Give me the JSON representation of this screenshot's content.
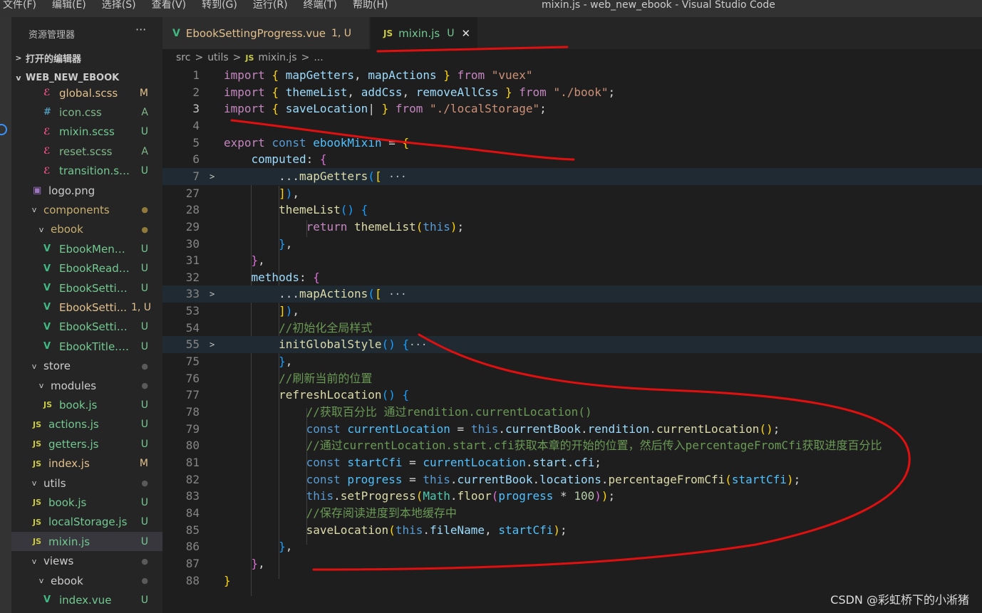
{
  "menu": [
    "文件(F)",
    "编辑(E)",
    "选择(S)",
    "查看(V)",
    "转到(G)",
    "运行(R)",
    "终端(T)",
    "帮助(H)"
  ],
  "window_title": "mixin.js - web_new_ebook - Visual Studio Code",
  "sidebar": {
    "header": "资源管理器",
    "more": "···",
    "open_editors": "打开的编辑器",
    "project": "WEB_NEW_EBOOK",
    "tree": [
      {
        "name": "global.scss",
        "icon": "scss-icon",
        "badge": "M",
        "status": "modified"
      },
      {
        "name": "icon.css",
        "icon": "css-icon",
        "badge": "A",
        "status": "added"
      },
      {
        "name": "mixin.scss",
        "icon": "scss-icon",
        "badge": "U",
        "status": "untracked"
      },
      {
        "name": "reset.scss",
        "icon": "scss-icon",
        "badge": "A",
        "status": "added"
      },
      {
        "name": "transition.scss",
        "icon": "scss-icon",
        "badge": "U",
        "status": "untracked"
      },
      {
        "name": "logo.png",
        "icon": "image-icon",
        "badge": "",
        "status": "plain"
      },
      {
        "name": "components",
        "icon": "folder",
        "badge": "●",
        "status": "folder-mod"
      },
      {
        "name": "ebook",
        "icon": "folder",
        "badge": "●",
        "status": "folder-mod"
      },
      {
        "name": "EbookMenu....",
        "icon": "vue-icon",
        "badge": "U",
        "status": "untracked"
      },
      {
        "name": "EbookReade...",
        "icon": "vue-icon",
        "badge": "U",
        "status": "untracked"
      },
      {
        "name": "EbookSettin...",
        "icon": "vue-icon",
        "badge": "U",
        "status": "untracked"
      },
      {
        "name": "EbookSetti...",
        "icon": "vue-icon",
        "badge": "1, U",
        "status": "conflict"
      },
      {
        "name": "EbookSettin...",
        "icon": "vue-icon",
        "badge": "U",
        "status": "untracked"
      },
      {
        "name": "EbookTitle.v...",
        "icon": "vue-icon",
        "badge": "U",
        "status": "untracked"
      },
      {
        "name": "store",
        "icon": "folder",
        "badge": "●",
        "status": "folder"
      },
      {
        "name": "modules",
        "icon": "folder",
        "badge": "●",
        "status": "folder"
      },
      {
        "name": "book.js",
        "icon": "js-icon",
        "badge": "U",
        "status": "untracked"
      },
      {
        "name": "actions.js",
        "icon": "js-icon",
        "badge": "U",
        "status": "untracked"
      },
      {
        "name": "getters.js",
        "icon": "js-icon",
        "badge": "U",
        "status": "untracked"
      },
      {
        "name": "index.js",
        "icon": "js-icon",
        "badge": "M",
        "status": "modified"
      },
      {
        "name": "utils",
        "icon": "folder",
        "badge": "●",
        "status": "folder"
      },
      {
        "name": "book.js",
        "icon": "js-icon",
        "badge": "U",
        "status": "untracked"
      },
      {
        "name": "localStorage.js",
        "icon": "js-icon",
        "badge": "U",
        "status": "untracked"
      },
      {
        "name": "mixin.js",
        "icon": "js-icon",
        "badge": "U",
        "status": "untracked",
        "selected": true
      },
      {
        "name": "views",
        "icon": "folder",
        "badge": "●",
        "status": "folder"
      },
      {
        "name": "ebook",
        "icon": "folder",
        "badge": "●",
        "status": "folder"
      },
      {
        "name": "index.vue",
        "icon": "vue-icon",
        "badge": "U",
        "status": "untracked"
      }
    ]
  },
  "tabs": [
    {
      "label": "EbookSettingProgress.vue",
      "badge": "1, U",
      "icon": "vue-icon",
      "active": false
    },
    {
      "label": "mixin.js",
      "badge": "U",
      "icon": "js-icon",
      "active": true,
      "close": "✕"
    }
  ],
  "breadcrumb": [
    "src",
    ">",
    "utils",
    ">",
    "JS",
    "mixin.js",
    ">",
    "..."
  ],
  "code_lines": [
    {
      "n": "1",
      "html": "<span class=\"kw\">import</span> <span class=\"b1\">{</span> <span class=\"var\">mapGetters</span>, <span class=\"var\">mapActions</span> <span class=\"b1\">}</span> <span class=\"kw\">from</span> <span class=\"str\">\"vuex\"</span>"
    },
    {
      "n": "2",
      "html": "<span class=\"kw\">import</span> <span class=\"b1\">{</span> <span class=\"var\">themeList</span>, <span class=\"var\">addCss</span>, <span class=\"var\">removeAllCss</span> <span class=\"b1\">}</span> <span class=\"kw\">from</span> <span class=\"str\">\"./book\"</span>;"
    },
    {
      "n": "3",
      "html": "<span class=\"kw\">import</span> <span class=\"b1\">{</span> <span class=\"var\">saveLocation</span>| <span class=\"b1\">}</span> <span class=\"kw\">from</span> <span class=\"str\">\"./localStorage\"</span>;",
      "active": true
    },
    {
      "n": "4",
      "html": ""
    },
    {
      "n": "5",
      "html": "<span class=\"kw\">export</span> <span class=\"kw2\">const</span> <span class=\"cst\">ebookMixin</span> = <span class=\"b1\">{</span>"
    },
    {
      "n": "6",
      "html": "    <span class=\"var\">computed</span>: <span class=\"b2\">{</span>"
    },
    {
      "n": "7",
      "html": "        ...<span class=\"fn\">mapGetters</span><span class=\"b3\">(</span><span class=\"b1\">[</span> <span class=\"ellip\">···</span>",
      "fold": true
    },
    {
      "n": "27",
      "html": "        <span class=\"b1\">]</span><span class=\"b3\">)</span>,"
    },
    {
      "n": "28",
      "html": "        <span class=\"fn\">themeList</span><span class=\"b3\">()</span> <span class=\"b3\">{</span>"
    },
    {
      "n": "29",
      "html": "            <span class=\"kw\">return</span> <span class=\"fn\">themeList</span><span class=\"b1\">(</span><span class=\"kw2\">this</span><span class=\"b1\">)</span>;"
    },
    {
      "n": "30",
      "html": "        <span class=\"b3\">}</span>,"
    },
    {
      "n": "31",
      "html": "    <span class=\"b2\">}</span>,"
    },
    {
      "n": "32",
      "html": "    <span class=\"var\">methods</span>: <span class=\"b2\">{</span>"
    },
    {
      "n": "33",
      "html": "        ...<span class=\"fn\">mapActions</span><span class=\"b3\">(</span><span class=\"b1\">[</span> <span class=\"ellip\">···</span>",
      "fold": true
    },
    {
      "n": "53",
      "html": "        <span class=\"b1\">]</span><span class=\"b3\">)</span>,"
    },
    {
      "n": "54",
      "html": "        <span class=\"cmt\">//初始化全局样式</span>"
    },
    {
      "n": "55",
      "html": "        <span class=\"fn\">initGlobalStyle</span><span class=\"b3\">()</span> <span class=\"b3\">{</span><span class=\"ellip\">···</span>",
      "fold": true
    },
    {
      "n": "75",
      "html": "        <span class=\"b3\">}</span>,"
    },
    {
      "n": "76",
      "html": "        <span class=\"cmt\">//刷新当前的位置</span>"
    },
    {
      "n": "77",
      "html": "        <span class=\"fn\">refreshLocation</span><span class=\"b3\">()</span> <span class=\"b3\">{</span>"
    },
    {
      "n": "78",
      "html": "            <span class=\"cmt\">//获取百分比 通过rendition.currentLocation()</span>"
    },
    {
      "n": "79",
      "html": "            <span class=\"kw2\">const</span> <span class=\"cst\">currentLocation</span> = <span class=\"kw2\">this</span>.<span class=\"var\">currentBook</span>.<span class=\"var\">rendition</span>.<span class=\"fn\">currentLocation</span><span class=\"b1\">()</span>;"
    },
    {
      "n": "80",
      "html": "            <span class=\"cmt\">//通过currentLocation.start.cfi获取本章的开始的位置，然后传入percentageFromCfi获取进度百分比</span>"
    },
    {
      "n": "81",
      "html": "            <span class=\"kw2\">const</span> <span class=\"cst\">startCfi</span> = <span class=\"cst\">currentLocation</span>.<span class=\"var\">start</span>.<span class=\"var\">cfi</span>;"
    },
    {
      "n": "82",
      "html": "            <span class=\"kw2\">const</span> <span class=\"cst\">progress</span> = <span class=\"kw2\">this</span>.<span class=\"var\">currentBook</span>.<span class=\"var\">locations</span>.<span class=\"fn\">percentageFromCfi</span><span class=\"b1\">(</span><span class=\"cst\">startCfi</span><span class=\"b1\">)</span>;"
    },
    {
      "n": "83",
      "html": "            <span class=\"kw2\">this</span>.<span class=\"fn\">setProgress</span><span class=\"b1\">(</span><span class=\"cls\">Math</span>.<span class=\"fn\">floor</span><span class=\"b2\">(</span><span class=\"cst\">progress</span> * <span class=\"num\">100</span><span class=\"b2\">)</span><span class=\"b1\">)</span>;"
    },
    {
      "n": "84",
      "html": "            <span class=\"cmt\">//保存阅读进度到本地缓存中</span>"
    },
    {
      "n": "85",
      "html": "            <span class=\"fn\">saveLocation</span><span class=\"b1\">(</span><span class=\"kw2\">this</span>.<span class=\"var\">fileName</span>, <span class=\"cst\">startCfi</span><span class=\"b1\">)</span>;"
    },
    {
      "n": "86",
      "html": "        <span class=\"b3\">}</span>,"
    },
    {
      "n": "87",
      "html": "    <span class=\"b2\">}</span>,"
    },
    {
      "n": "88",
      "html": "<span class=\"b1\">}</span>"
    }
  ],
  "watermark": "CSDN @彩虹桥下的小淅猪",
  "colors": {
    "annotation": "#e01010",
    "accent": "#0078d4"
  }
}
